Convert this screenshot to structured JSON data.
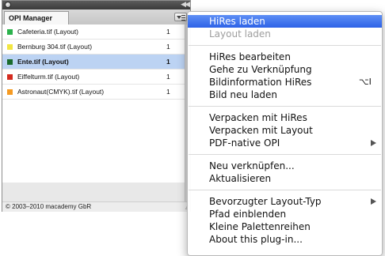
{
  "palette": {
    "tab_label": "OPI Manager",
    "footer_text": "© 2003–2010 macademy GbR",
    "files": [
      {
        "name": "Cafeteria.tif (Layout)",
        "count": "1",
        "color": "#2bb24c",
        "selected": false
      },
      {
        "name": "Bernburg 304.tif (Layout)",
        "count": "1",
        "color": "#f2e641",
        "selected": false
      },
      {
        "name": "Ente.tif (Layout)",
        "count": "1",
        "color": "#1a6b2c",
        "selected": true
      },
      {
        "name": "Eiffelturm.tif (Layout)",
        "count": "1",
        "color": "#d42b1f",
        "selected": false
      },
      {
        "name": "Astronaut(CMYK).tif (Layout)",
        "count": "1",
        "color": "#f59a22",
        "selected": false
      }
    ]
  },
  "menu": {
    "groups": [
      [
        {
          "label": "HiRes laden",
          "state": "highlighted"
        },
        {
          "label": "Layout laden",
          "state": "disabled"
        }
      ],
      [
        {
          "label": "HiRes bearbeiten",
          "state": "normal"
        },
        {
          "label": "Gehe zu Verknüpfung",
          "state": "normal"
        },
        {
          "label": "Bildinformation HiRes",
          "state": "normal",
          "shortcut": "⌥I"
        },
        {
          "label": "Bild neu laden",
          "state": "normal"
        }
      ],
      [
        {
          "label": "Verpacken mit HiRes",
          "state": "normal"
        },
        {
          "label": "Verpacken mit Layout",
          "state": "normal"
        },
        {
          "label": "PDF-native OPI",
          "state": "normal",
          "submenu": true
        }
      ],
      [
        {
          "label": "Neu verknüpfen...",
          "state": "normal"
        },
        {
          "label": "Aktualisieren",
          "state": "normal"
        }
      ],
      [
        {
          "label": "Bevorzugter Layout-Typ",
          "state": "normal",
          "submenu": true
        },
        {
          "label": "Pfad einblenden",
          "state": "normal"
        },
        {
          "label": "Kleine Palettenreihen",
          "state": "normal"
        },
        {
          "label": "About this plug-in...",
          "state": "normal"
        }
      ]
    ]
  },
  "colors": {
    "highlight": "#3a72ee",
    "selected_row": "#bcd3f3"
  }
}
